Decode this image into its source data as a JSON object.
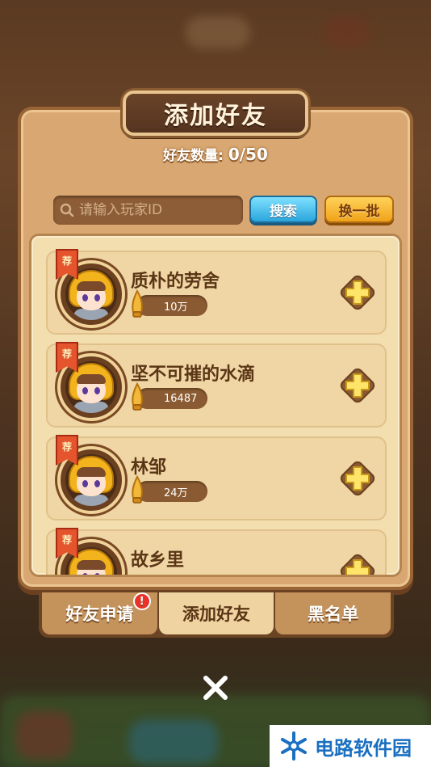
{
  "title": "添加好友",
  "friend_count": {
    "label": "好友数量:",
    "value": "0/50"
  },
  "search": {
    "placeholder": "请输入玩家ID",
    "search_label": "搜索",
    "refresh_label": "换一批"
  },
  "friends": [
    {
      "badge": "荐",
      "name": "质朴的劳舍",
      "power": "10万"
    },
    {
      "badge": "荐",
      "name": "坚不可摧的水滴",
      "power": "16487"
    },
    {
      "badge": "荐",
      "name": "林邹",
      "power": "24万"
    },
    {
      "badge": "荐",
      "name": "故乡里",
      "power": ""
    }
  ],
  "tabs": [
    {
      "label": "好友申请",
      "active": false,
      "notification": "!"
    },
    {
      "label": "添加好友",
      "active": true
    },
    {
      "label": "黑名单",
      "active": false
    }
  ],
  "icons": {
    "search": "search-icon",
    "add": "plus-icon",
    "power": "flame-icon",
    "close": "close-icon"
  },
  "colors": {
    "panel": "#d9a872",
    "search_button": "#2aa6dc",
    "refresh_button": "#f0a21a",
    "name_text": "#5a3516"
  },
  "watermark": {
    "text": "电路软件园"
  }
}
